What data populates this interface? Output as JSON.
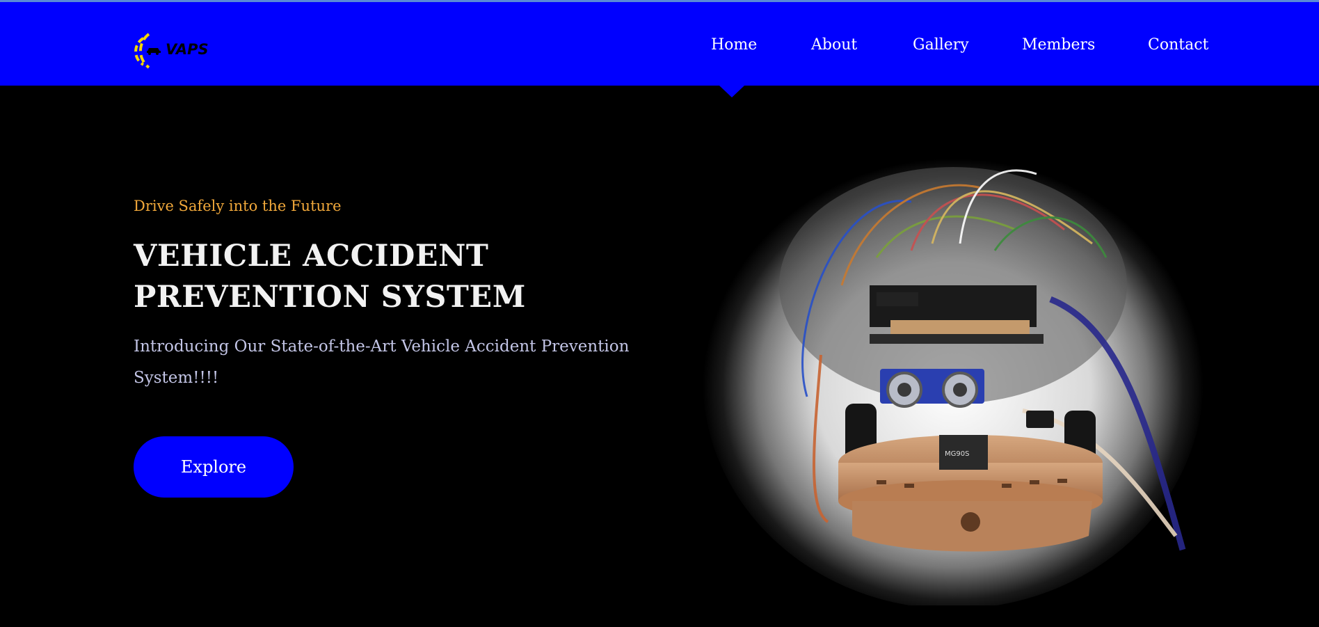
{
  "header": {
    "logo_text": "VAPS",
    "bg_color": "#0000ff",
    "nav": {
      "home": "Home",
      "about": "About",
      "gallery": "Gallery",
      "members": "Members",
      "contact": "Contact",
      "active": "Home"
    }
  },
  "hero": {
    "tagline": "Drive Safely into the Future",
    "title_line1": "VEHICLE ACCIDENT",
    "title_line2": "PREVENTION SYSTEM",
    "description": "Introducing Our State-of-the-Art Vehicle Accident Prevention System!!!!",
    "button_label": "Explore",
    "tagline_color": "#f2a93b",
    "accent_color": "#0000ff"
  },
  "icons": {
    "logo": "car-signal-logo-icon",
    "hero_image": "arduino-robot-car-photo"
  }
}
